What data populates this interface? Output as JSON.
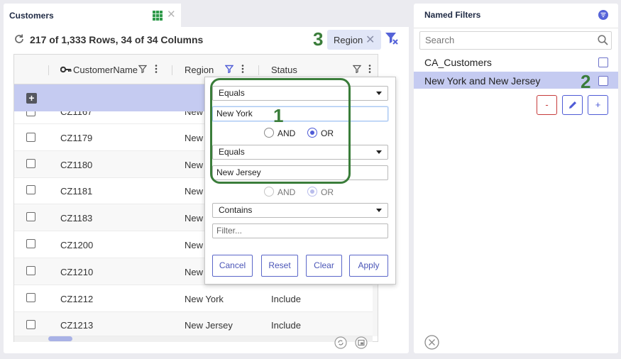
{
  "tab": {
    "title": "Customers",
    "close": "✕"
  },
  "toolbar": {
    "row_info": "217 of 1,333 Rows, 34 of 34 Columns",
    "callout": "3",
    "region_chip": {
      "label": "Region",
      "close": "✕"
    }
  },
  "grid": {
    "columns": [
      {
        "label": "CustomerName",
        "icon": "key-icon"
      },
      {
        "label": "Region"
      },
      {
        "label": "Status"
      }
    ],
    "add_row": "+",
    "rows": [
      {
        "name": "CZ1167",
        "region": "New",
        "status": ""
      },
      {
        "name": "CZ1179",
        "region": "New",
        "status": ""
      },
      {
        "name": "CZ1180",
        "region": "New",
        "status": ""
      },
      {
        "name": "CZ1181",
        "region": "New",
        "status": ""
      },
      {
        "name": "CZ1183",
        "region": "New",
        "status": ""
      },
      {
        "name": "CZ1200",
        "region": "New",
        "status": ""
      },
      {
        "name": "CZ1210",
        "region": "New",
        "status": ""
      },
      {
        "name": "CZ1212",
        "region": "New York",
        "status": "Include"
      },
      {
        "name": "CZ1213",
        "region": "New Jersey",
        "status": "Include"
      }
    ]
  },
  "filter_popup": {
    "condition1": {
      "operator": "Equals",
      "value": "New York"
    },
    "join1": {
      "and": "AND",
      "or": "OR",
      "selected": "OR"
    },
    "condition2": {
      "operator": "Equals",
      "value": "New Jersey"
    },
    "join2": {
      "and": "AND",
      "or": "OR",
      "selected": "OR"
    },
    "condition3": {
      "operator": "Contains",
      "placeholder": "Filter..."
    },
    "buttons": {
      "cancel": "Cancel",
      "reset": "Reset",
      "clear": "Clear",
      "apply": "Apply"
    },
    "callout": "1"
  },
  "named_filters": {
    "title": "Named Filters",
    "search_placeholder": "Search",
    "items": [
      {
        "label": "CA_Customers",
        "selected": false
      },
      {
        "label": "New York and New Jersey",
        "selected": true
      }
    ],
    "callout": "2",
    "buttons": {
      "remove": "-",
      "edit": "✎",
      "add": "+"
    }
  },
  "colors": {
    "accent": "#4e5bd6",
    "selection": "#c5cbf1",
    "callout_green": "#3a7d3a",
    "danger": "#c63b3b"
  }
}
